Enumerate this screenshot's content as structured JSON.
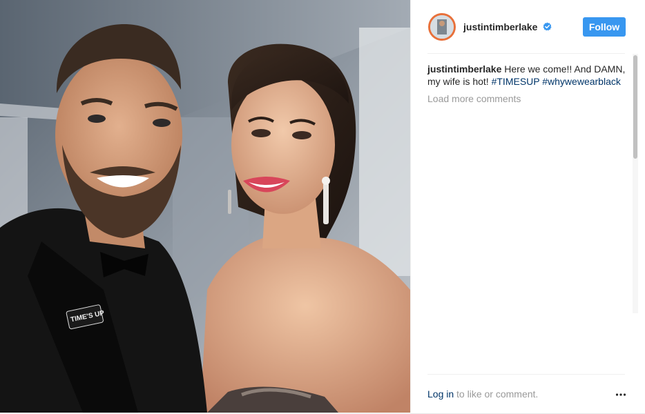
{
  "post": {
    "image_alt": "Selfie of a man in a black tuxedo wearing a TIME'S UP pin and a smiling woman with red lipstick and drop earrings",
    "pin_text": "TIME'S UP"
  },
  "header": {
    "username": "justintimberlake",
    "verified_icon": "verified-badge-icon",
    "follow_label": "Follow"
  },
  "caption": {
    "username": "justintimberlake",
    "text": "Here we come!! And DAMN, my wife is hot!",
    "hashtag_1": "#TIMESUP",
    "hashtag_2": "#whywewearblack"
  },
  "comments": {
    "load_more_label": "Load more comments"
  },
  "footer": {
    "login_label": "Log in",
    "prompt_text": "to like or comment.",
    "more_icon": "more-options-icon"
  },
  "colors": {
    "accent": "#3897f0",
    "link": "#003569",
    "muted": "#999999",
    "avatar_ring": "#e8703a"
  }
}
